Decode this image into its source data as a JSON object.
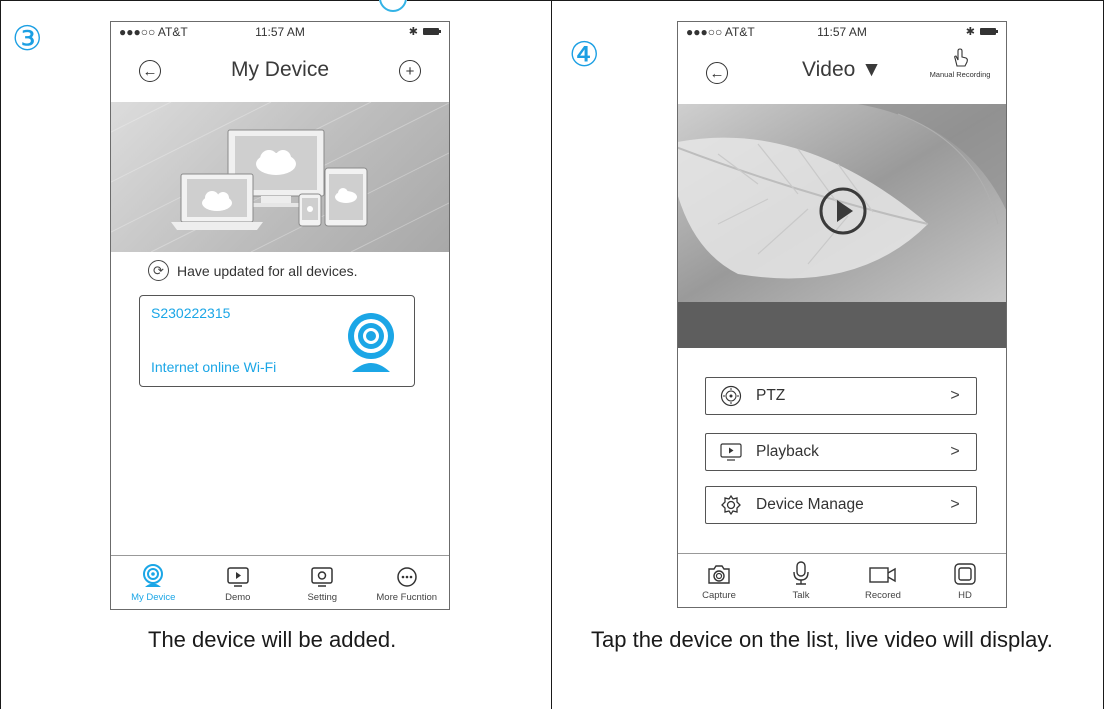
{
  "steps": [
    {
      "number": "③",
      "caption": "The device will be added.",
      "phone": {
        "carrier": "●●●○○ AT&T",
        "time": "11:57 AM",
        "title": "My Device",
        "update_text": "Have updated for all devices.",
        "device": {
          "id": "S230222315",
          "status": "Internet online Wi-Fi"
        },
        "tabs": [
          {
            "label": "My Device",
            "icon": "camera-icon",
            "active": true
          },
          {
            "label": "Demo",
            "icon": "play-icon",
            "active": false
          },
          {
            "label": "Setting",
            "icon": "gear-icon",
            "active": false
          },
          {
            "label": "More Fucntion",
            "icon": "more-icon",
            "active": false
          }
        ]
      }
    },
    {
      "number": "④",
      "caption": "Tap the device on the list, live video will display.",
      "phone": {
        "carrier": "●●●○○ AT&T",
        "time": "11:57 AM",
        "title": "Video ▼",
        "manual_recording": "Manual Recording",
        "menu": [
          {
            "label": "PTZ",
            "icon": "ptz-icon"
          },
          {
            "label": "Playback",
            "icon": "playback-icon"
          },
          {
            "label": "Device Manage",
            "icon": "gear-icon"
          }
        ],
        "toolbar": [
          {
            "label": "Capture",
            "icon": "capture-icon"
          },
          {
            "label": "Talk",
            "icon": "microphone-icon"
          },
          {
            "label": "Recored",
            "icon": "video-camera-icon"
          },
          {
            "label": "HD",
            "icon": "hd-icon"
          }
        ]
      }
    }
  ],
  "colors": {
    "accent": "#1ba6e6",
    "border": "#1a1a1a"
  }
}
